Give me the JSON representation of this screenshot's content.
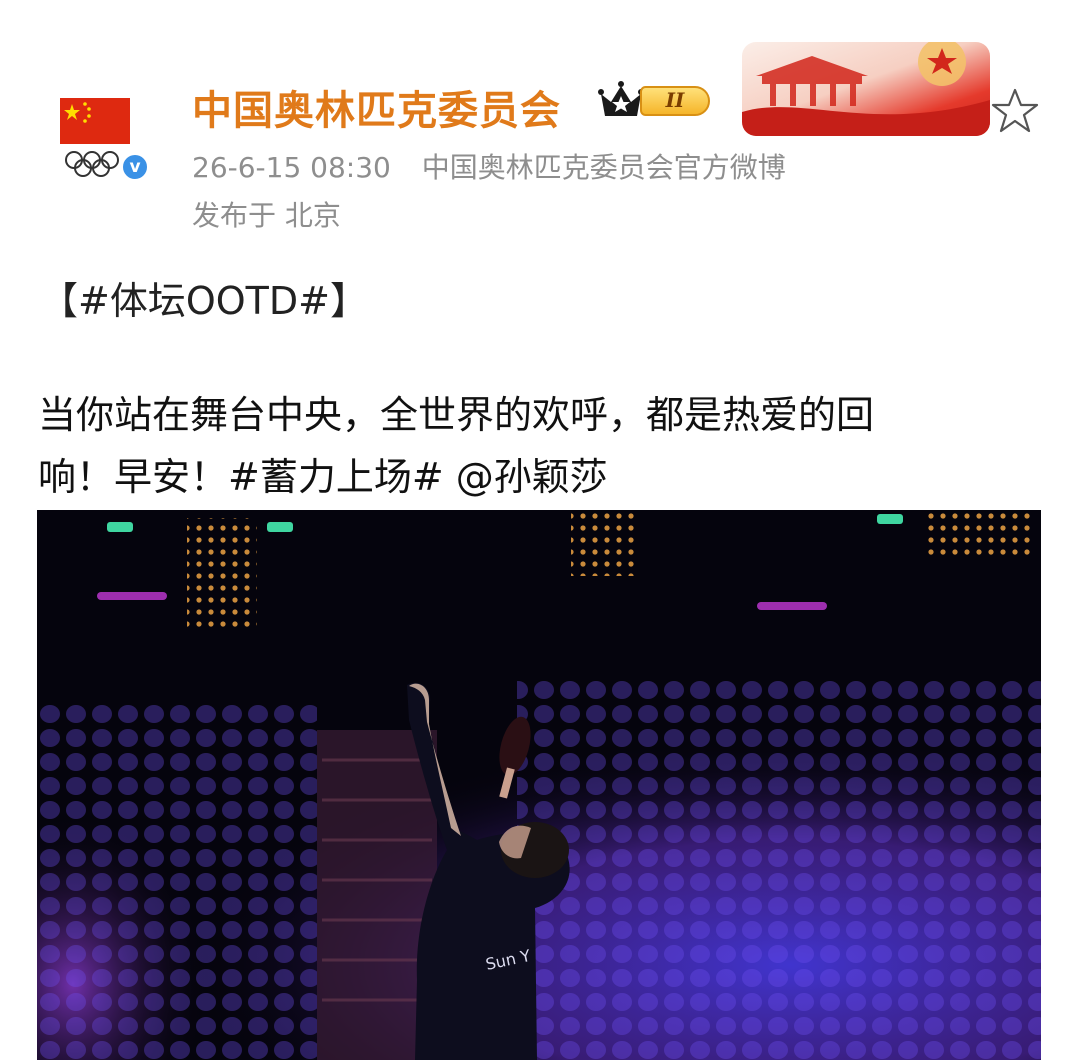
{
  "post": {
    "author_name": "中国奥林匹克委员会",
    "level_badge": "II",
    "timestamp": "26-6-15 08:30",
    "source": "中国奥林匹克委员会官方微博",
    "location": "发布于 北京",
    "topic_line": "【#体坛OOTD#】",
    "text_line1": "当你站在舞台中央，全世界的欢呼，都是热爱的回",
    "text_line2_prefix": "响！早安！",
    "hashtag": "#蓄力上场#",
    "mention": "@孙颖莎",
    "verified_mark": "v"
  },
  "icons": {
    "flag": "china-flag-icon",
    "rings": "olympic-rings-icon",
    "verified": "verified-badge-icon",
    "crown": "crown-icon",
    "favorite": "star-outline-icon"
  },
  "colors": {
    "author_name": "#e07a1a",
    "meta_text": "#8e8e8e",
    "flag_red": "#de2910",
    "verified_blue": "#3a91e6",
    "photo_crowd": "#5a3ad8"
  }
}
